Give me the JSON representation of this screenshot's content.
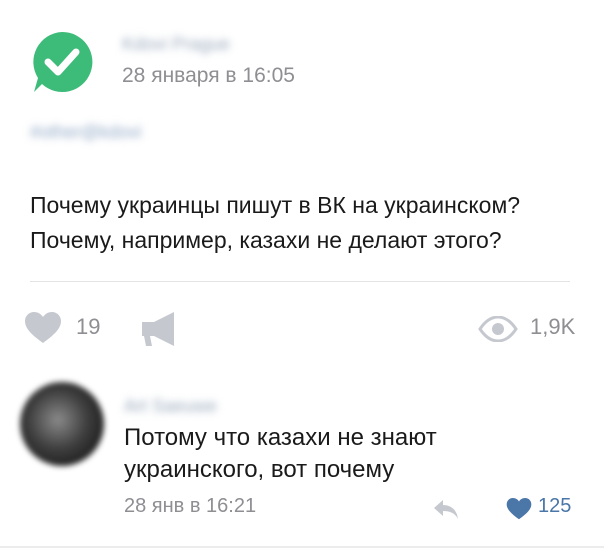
{
  "post": {
    "author_name": "Kdovi Prague",
    "date": "28 января в 16:05",
    "hashtag": "#other@kdovi",
    "text_lines": [
      "Почему украинцы пишут в ВК на украинском?",
      "Почему, например, казахи не делают этого?"
    ],
    "likes": "19",
    "views": "1,9K"
  },
  "comment": {
    "author_name": "Art Saeuwe",
    "text_lines": [
      "Потому что казахи не знают",
      "украинского, вот почему"
    ],
    "date": "28 янв в 16:21",
    "likes": "125"
  },
  "colors": {
    "brand_green": "#3dbb78",
    "meta_gray": "#8e8e93",
    "icon_gray": "#c5c9cf",
    "like_blue": "#4a76a8"
  },
  "icons": {
    "author_avatar": "green-check-speech-bubble-logo",
    "like": "heart-icon",
    "share": "megaphone-icon",
    "views": "eye-icon",
    "reply": "reply-arrow-icon",
    "comment_like": "heart-icon"
  }
}
